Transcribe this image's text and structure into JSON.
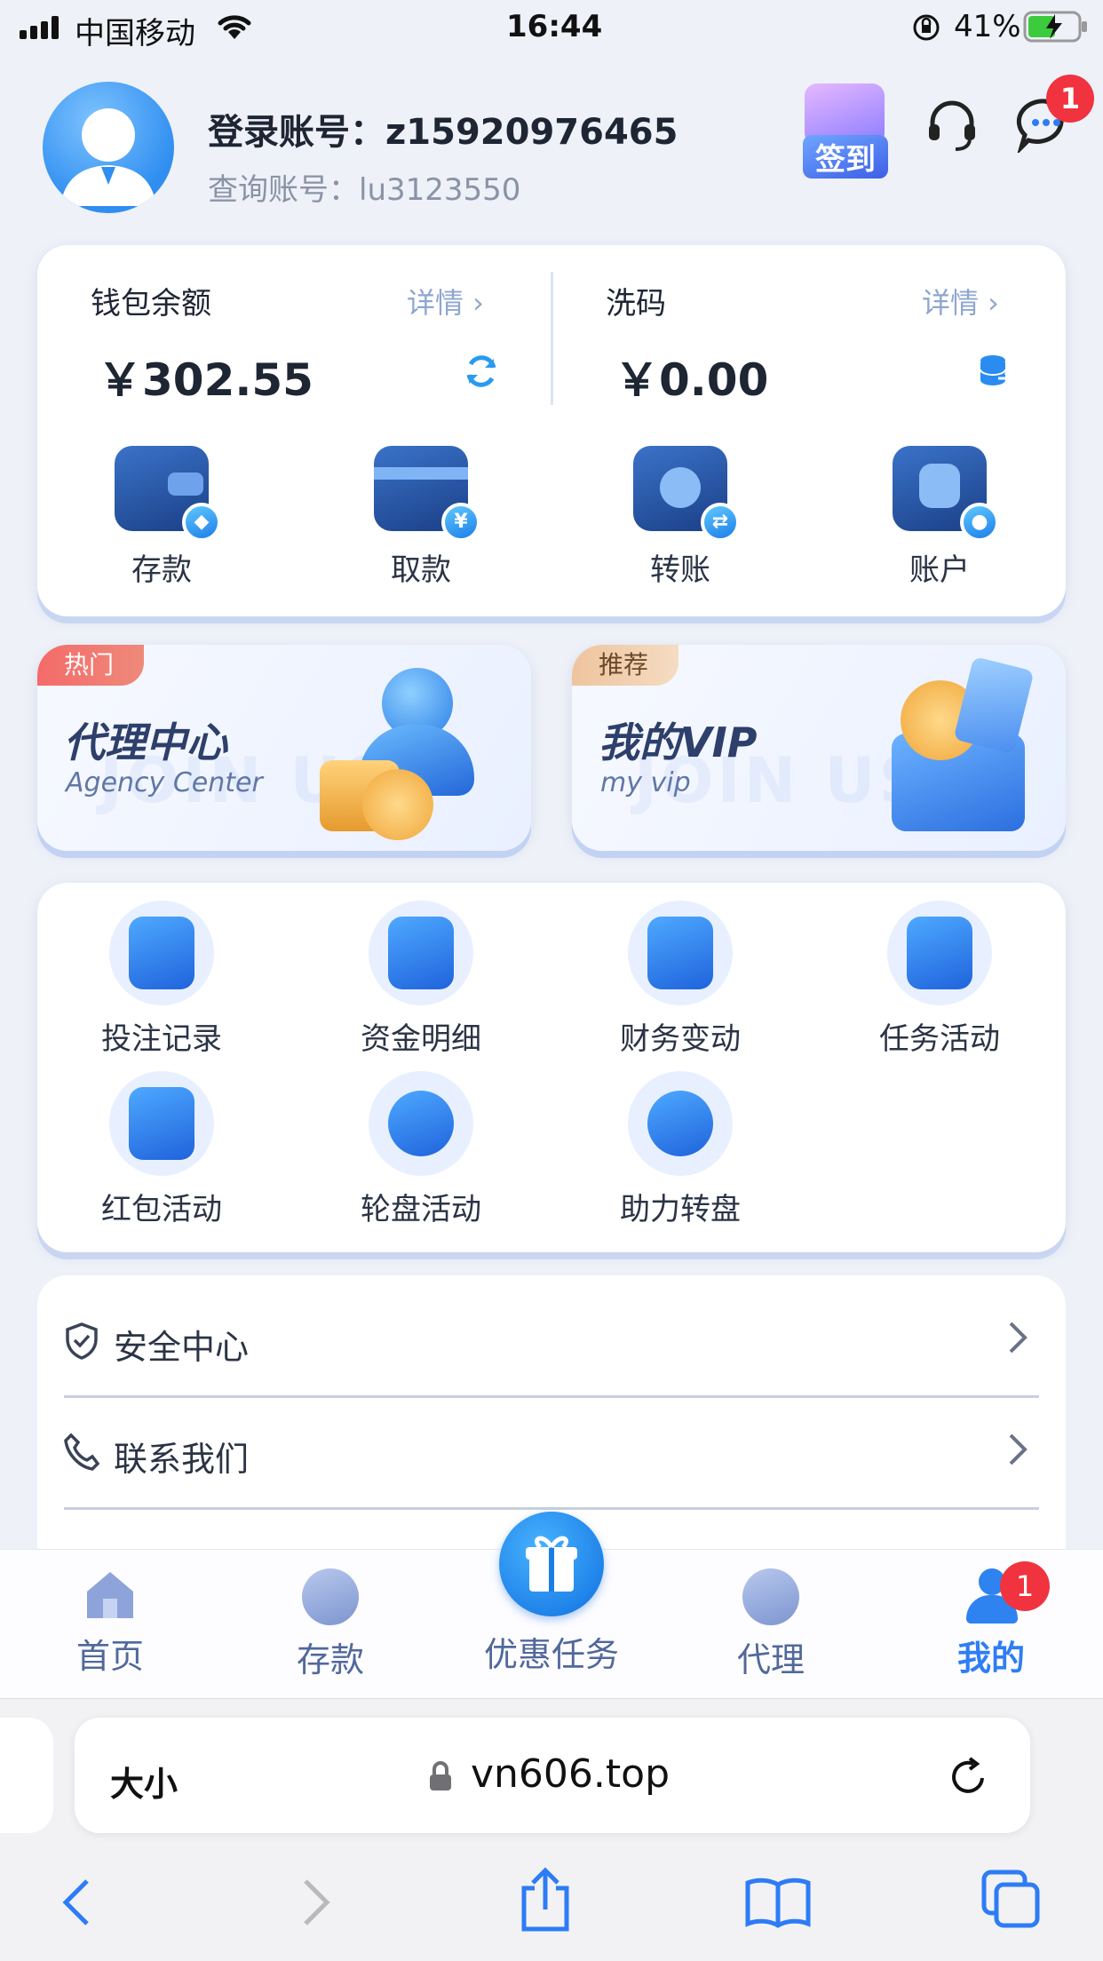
{
  "status": {
    "carrier": "中国移动",
    "time": "16:44",
    "battery": "41%"
  },
  "header": {
    "login_label": "登录账号：",
    "login_value": "z15920976465",
    "query_label": "查询账号：",
    "query_value": "lu3123550",
    "checkin_label": "签到",
    "message_badge": "1"
  },
  "wallet": {
    "balance_title": "钱包余额",
    "balance_detail": "详情 ›",
    "balance_amount": "￥302.55",
    "wash_title": "洗码",
    "wash_detail": "详情 ›",
    "wash_amount": "￥0.00",
    "actions": [
      {
        "label": "存款",
        "icon": "wallet-icon",
        "badge": "◆"
      },
      {
        "label": "取款",
        "icon": "card-icon",
        "badge": "¥"
      },
      {
        "label": "转账",
        "icon": "transfer-icon",
        "badge": "⇄"
      },
      {
        "label": "账户",
        "icon": "account-icon",
        "badge": "●"
      }
    ]
  },
  "promos": [
    {
      "tag": "热门",
      "title": "代理中心",
      "subtitle": "Agency Center",
      "watermark": "JOIN US",
      "tag_color": "#ee6b6b"
    },
    {
      "tag": "推荐",
      "title": "我的VIP",
      "subtitle": "my vip",
      "watermark": "JOIN US",
      "tag_color": "#e8b98c"
    }
  ],
  "features": [
    {
      "label": "投注记录",
      "icon": "bet-record-icon"
    },
    {
      "label": "资金明细",
      "icon": "fund-detail-icon"
    },
    {
      "label": "财务变动",
      "icon": "finance-change-icon"
    },
    {
      "label": "任务活动",
      "icon": "task-activity-icon"
    },
    {
      "label": "红包活动",
      "icon": "red-packet-icon"
    },
    {
      "label": "轮盘活动",
      "icon": "roulette-icon"
    },
    {
      "label": "助力转盘",
      "icon": "boost-wheel-icon"
    }
  ],
  "menu": [
    {
      "label": "安全中心",
      "icon": "shield-icon"
    },
    {
      "label": "联系我们",
      "icon": "phone-icon"
    }
  ],
  "tabbar": {
    "home": "首页",
    "deposit": "存款",
    "promo": "优惠任务",
    "agent": "代理",
    "mine": "我的",
    "mine_badge": "1"
  },
  "browser": {
    "text_size": "大小",
    "url": "vn606.top"
  },
  "colors": {
    "accent": "#2d7cf6",
    "badge": "#f0333f"
  }
}
